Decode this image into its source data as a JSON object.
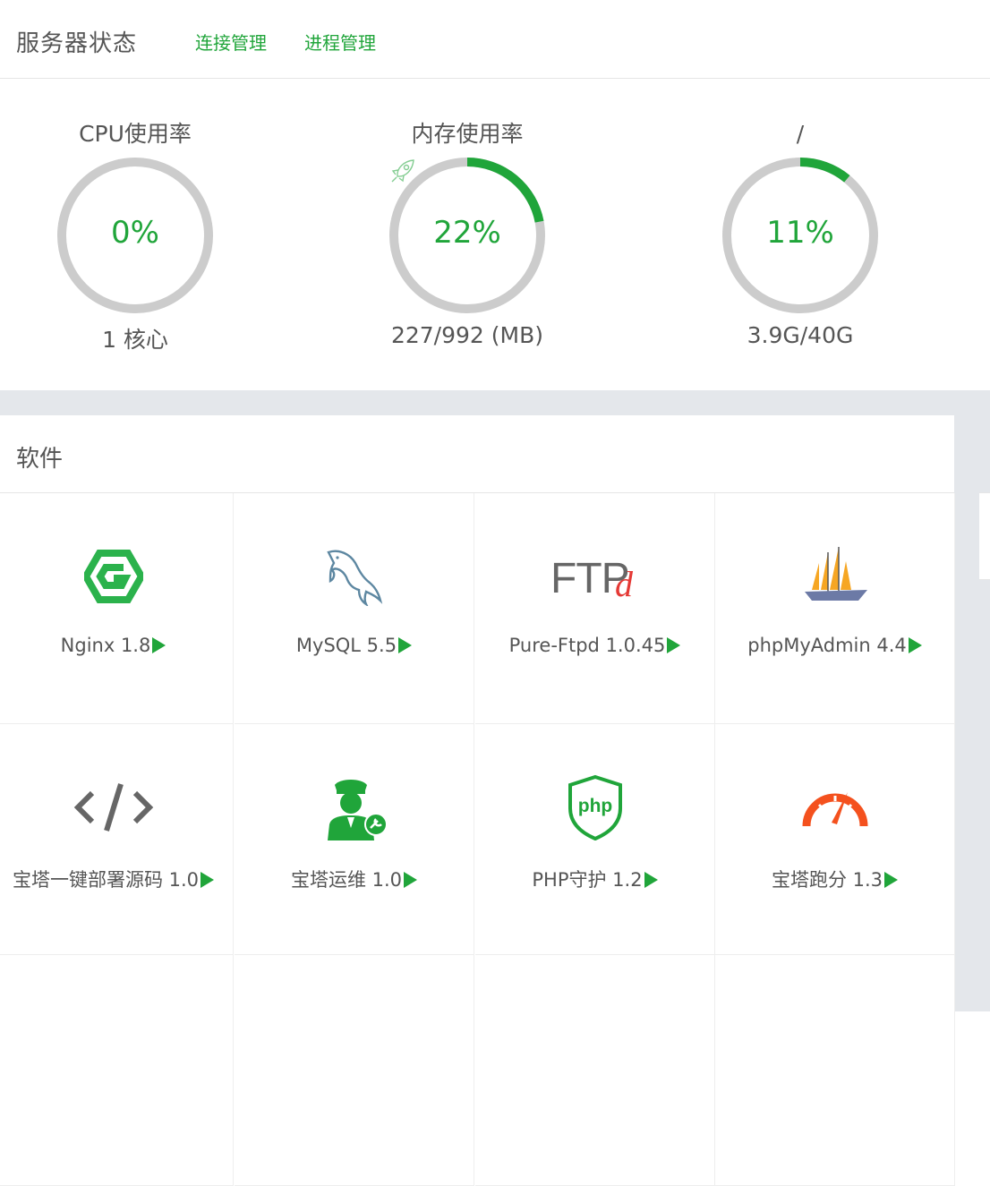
{
  "header": {
    "title": "服务器状态",
    "links": [
      "连接管理",
      "进程管理"
    ]
  },
  "gauges": [
    {
      "title": "CPU使用率",
      "value": "0%",
      "detail": "1 核心",
      "fraction": 0.0
    },
    {
      "title": "内存使用率",
      "value": "22%",
      "detail": "227/992 (MB)",
      "fraction": 0.22
    },
    {
      "title": "/",
      "value": "11%",
      "detail": "3.9G/40G",
      "fraction": 0.11
    }
  ],
  "software": {
    "title": "软件",
    "items": [
      {
        "name": "Nginx 1.8",
        "icon": "nginx-icon"
      },
      {
        "name": "MySQL 5.5",
        "icon": "mysql-dolphin-icon"
      },
      {
        "name": "Pure-Ftpd 1.0.45",
        "icon": "ftp-icon"
      },
      {
        "name": "phpMyAdmin 4.4",
        "icon": "sailboat-icon"
      },
      {
        "name": "宝塔一键部署源码 1.0",
        "icon": "code-icon"
      },
      {
        "name": "宝塔运维 1.0",
        "icon": "operator-icon"
      },
      {
        "name": "PHP守护 1.2",
        "icon": "php-shield-icon"
      },
      {
        "name": "宝塔跑分 1.3",
        "icon": "speedometer-icon"
      }
    ]
  },
  "colors": {
    "accent": "#20a53a",
    "track": "#cccccc",
    "band": "#e4e7eb"
  }
}
